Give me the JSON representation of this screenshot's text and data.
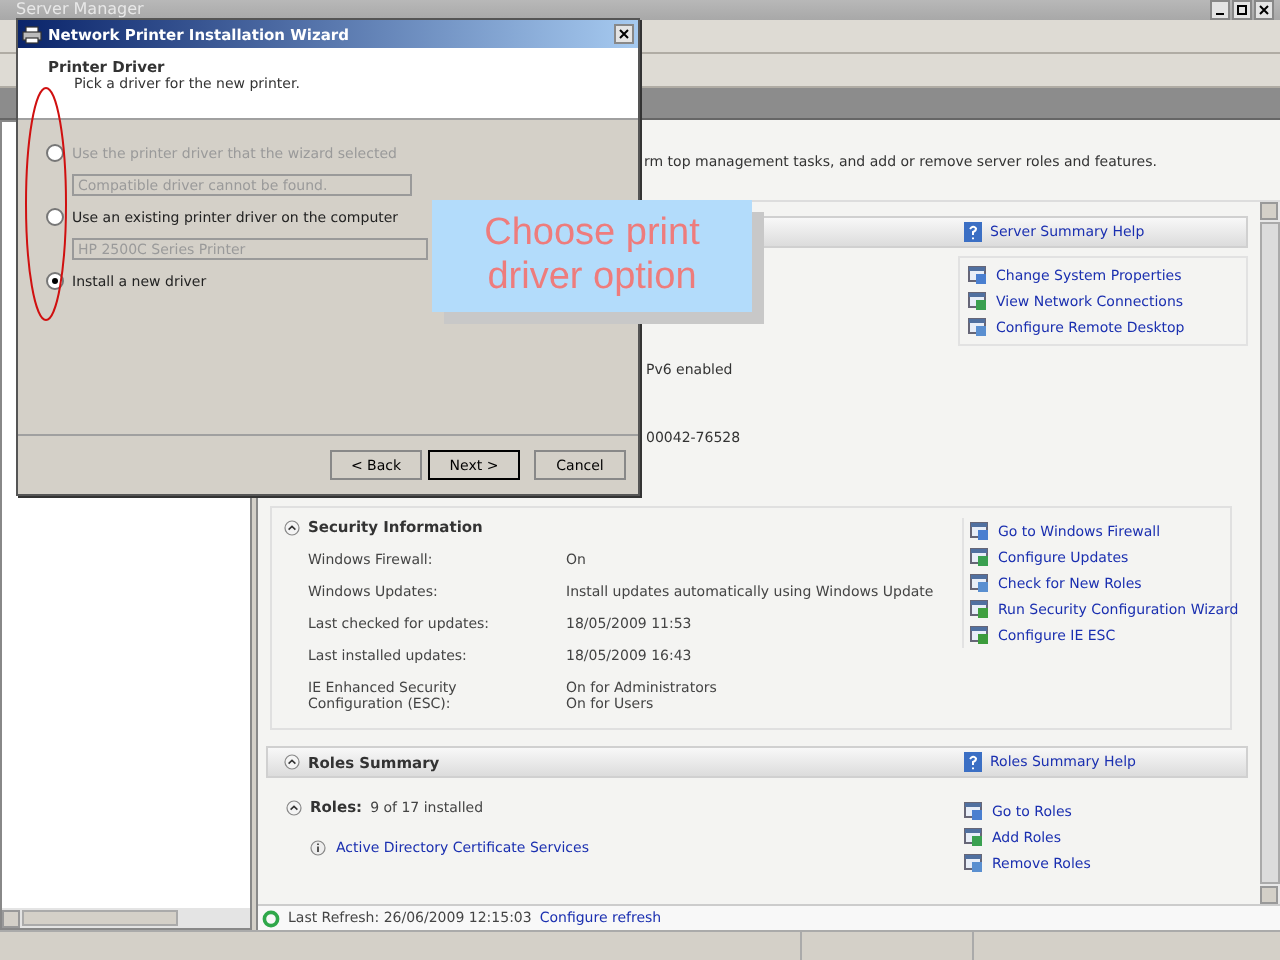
{
  "server_manager": {
    "title": "Server Manager",
    "description": "rm top management tasks, and add or remove server roles and features.",
    "server_summary": {
      "help": "Server Summary Help",
      "fragments": [
        "Pv6 enabled",
        "00042-76528"
      ],
      "links": [
        "Change System Properties",
        "View Network Connections",
        "Configure Remote Desktop"
      ]
    },
    "security": {
      "title": "Security Information",
      "expanded": true,
      "rows": [
        {
          "label": "Windows Firewall:",
          "values": [
            "On"
          ]
        },
        {
          "label": "Windows Updates:",
          "values": [
            "Install updates automatically using Windows Update"
          ]
        },
        {
          "label": "Last checked for updates:",
          "values": [
            "18/05/2009 11:53"
          ]
        },
        {
          "label": "Last installed updates:",
          "values": [
            "18/05/2009 16:43"
          ]
        },
        {
          "label": "IE Enhanced Security Configuration (ESC):",
          "values": [
            "On for Administrators",
            "On for Users"
          ]
        }
      ],
      "links": [
        "Go to Windows Firewall",
        "Configure Updates",
        "Check for New Roles",
        "Run Security Configuration Wizard",
        "Configure IE ESC"
      ]
    },
    "roles_summary": {
      "title": "Roles Summary",
      "expanded": true,
      "help": "Roles Summary Help",
      "roles_label": "Roles:",
      "roles_count": "9 of 17 installed",
      "roles_expanded": true,
      "roles": [
        "Active Directory Certificate Services"
      ],
      "links": [
        "Go to Roles",
        "Add Roles",
        "Remove Roles"
      ]
    },
    "status": {
      "last_refresh": "Last Refresh: 26/06/2009 12:15:03",
      "link": "Configure refresh"
    }
  },
  "wizard": {
    "title": "Network Printer Installation Wizard",
    "heading": "Printer Driver",
    "subheading": "Pick a driver for the new printer.",
    "options": [
      {
        "label": "Use the printer driver that the wizard selected",
        "selected": false,
        "disabled": true,
        "field": "Compatible driver cannot be found."
      },
      {
        "label": "Use an existing printer driver on the computer",
        "selected": false,
        "disabled": false,
        "field": "HP 2500C Series Printer"
      },
      {
        "label": "Install a new driver",
        "selected": true,
        "disabled": false
      }
    ],
    "buttons": [
      {
        "label": "< Back",
        "default": false
      },
      {
        "label": "Next >",
        "default": true
      },
      {
        "label": "Cancel",
        "default": false
      }
    ]
  },
  "callout": {
    "lines": [
      "Choose print",
      "driver option"
    ]
  }
}
